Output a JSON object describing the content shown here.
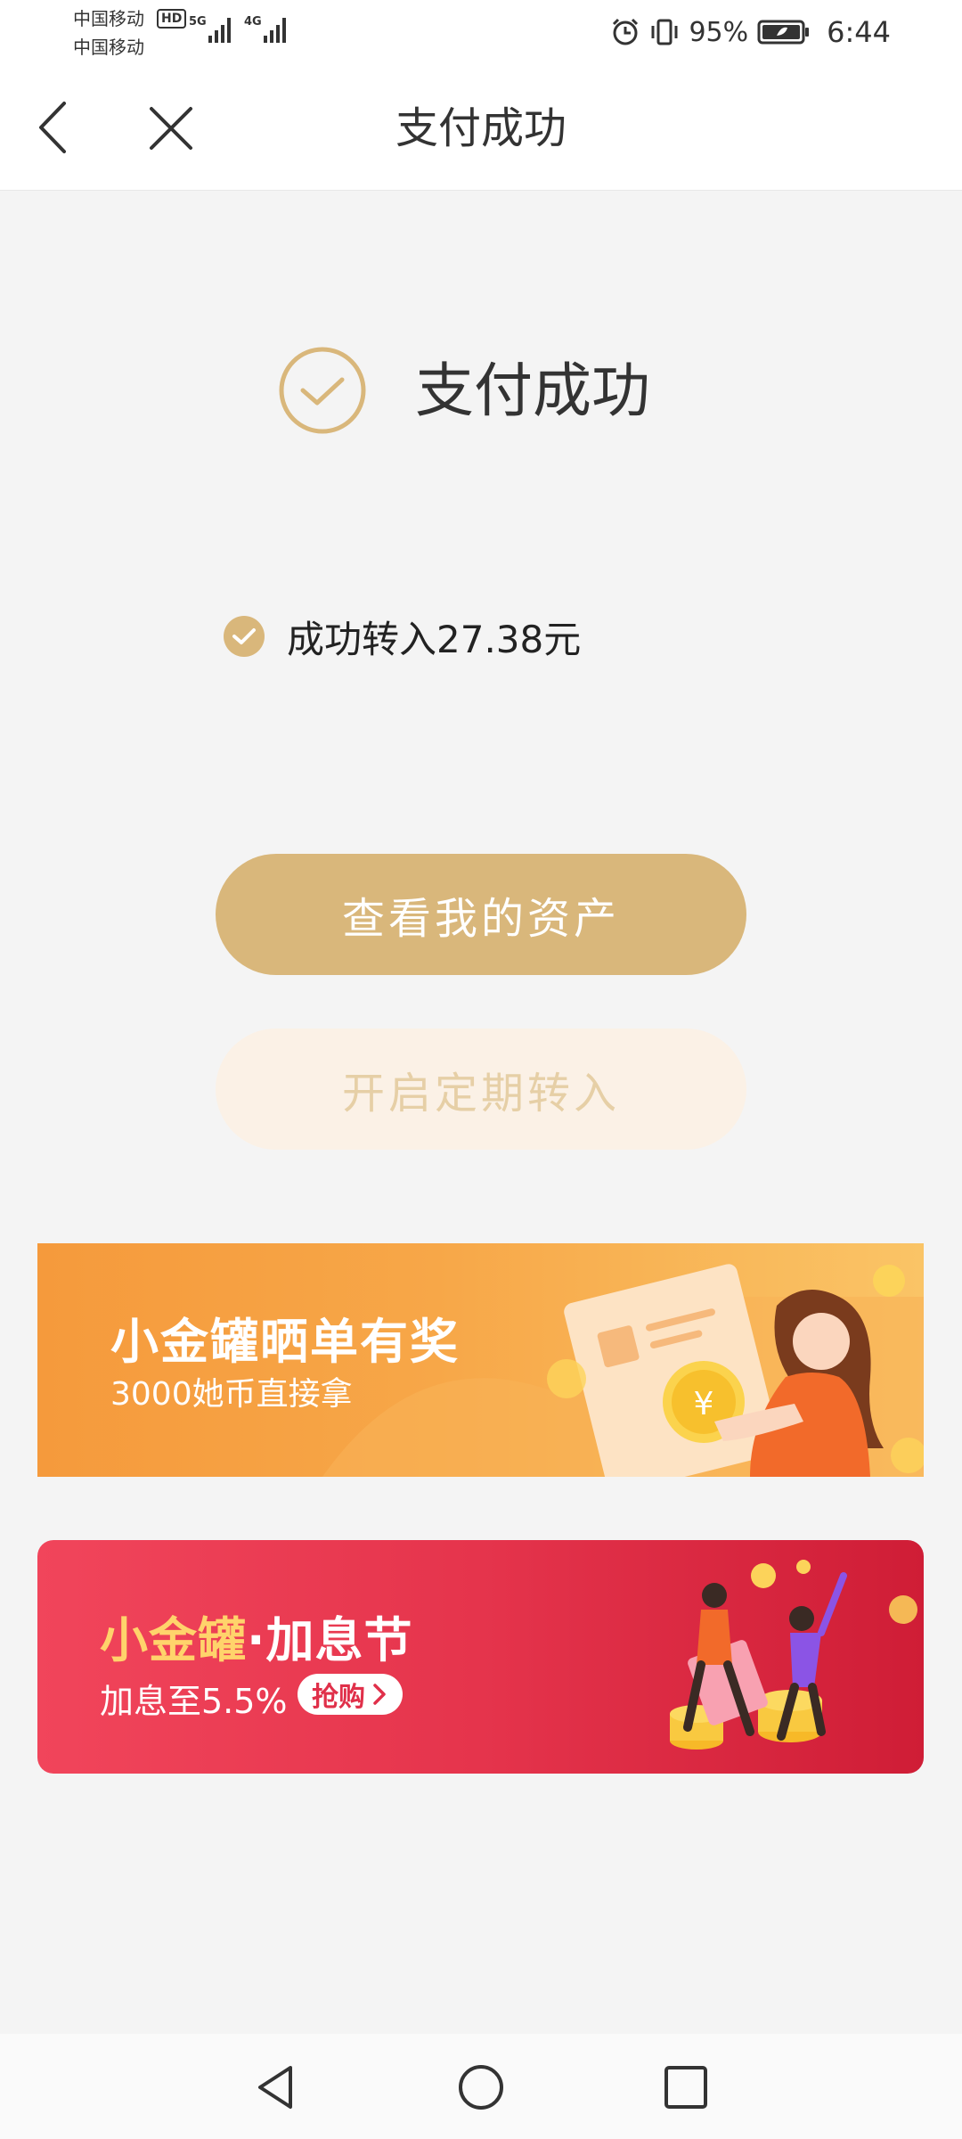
{
  "status_bar": {
    "carrier_1": "中国移动",
    "carrier_2": "中国移动",
    "hd": "HD",
    "net_1": "5G",
    "net_2": "4G",
    "battery_pct": "95%",
    "time": "6:44"
  },
  "nav": {
    "title": "支付成功"
  },
  "result": {
    "title": "支付成功",
    "detail": "成功转入27.38元"
  },
  "buttons": {
    "primary": "查看我的资产",
    "secondary": "开启定期转入"
  },
  "banner1": {
    "title": "小金罐晒单有奖",
    "subtitle": "3000她币直接拿"
  },
  "banner2": {
    "title_gold": "小金罐",
    "title_white": "·加息节",
    "subtitle": "加息至5.5%",
    "buy_label": "抢购"
  },
  "colors": {
    "accent_gold": "#d9b77b",
    "banner1_orange": "#f59a3c",
    "banner2_red": "#e5344c"
  }
}
